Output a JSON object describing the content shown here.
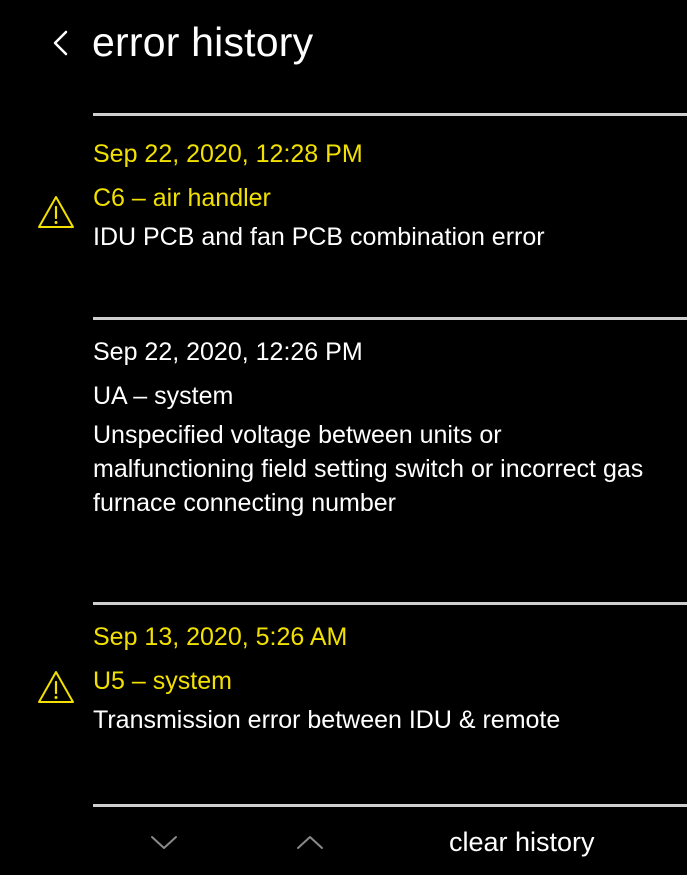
{
  "header": {
    "title": "error history",
    "back_icon": "chevron-left-icon"
  },
  "entries": [
    {
      "date": "Sep 22, 2020, 12:28 PM",
      "code": "C6 – air handler",
      "description": "IDU PCB and fan PCB combination error",
      "active": true
    },
    {
      "date": "Sep 22, 2020, 12:26 PM",
      "code": "UA – system",
      "description": "Unspecified voltage between units or malfunctioning field setting switch or incorrect gas furnace connecting number",
      "active": false
    },
    {
      "date": "Sep 13, 2020, 5:26 AM",
      "code": "U5 – system",
      "description": "Transmission error between IDU & remote",
      "active": true
    }
  ],
  "footer": {
    "scroll_down_icon": "chevron-down-icon",
    "scroll_up_icon": "chevron-up-icon",
    "clear_label": "clear history"
  },
  "colors": {
    "background": "#000000",
    "text": "#ffffff",
    "active_error": "#f2e000",
    "divider": "#cfcfcf",
    "footer_icon": "#8a8a8a"
  }
}
